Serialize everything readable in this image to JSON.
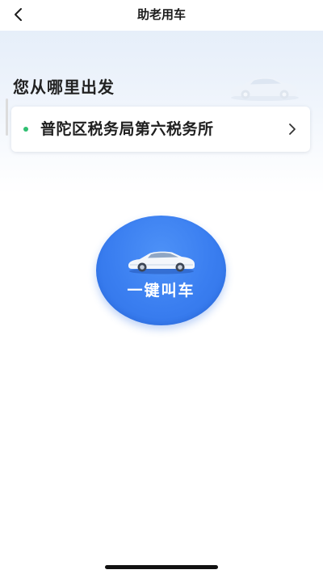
{
  "nav": {
    "title": "助老用车",
    "back_icon": "chevron-left-icon"
  },
  "origin": {
    "heading": "您从哪里出发",
    "location": "普陀区税务局第六税务所",
    "dot_color": "#2fbf71",
    "arrow_icon": "chevron-right-icon"
  },
  "call": {
    "label": "一键叫车",
    "icon": "car-icon",
    "color": "#3a7ef0"
  },
  "decoration": {
    "icon": "car-icon"
  }
}
